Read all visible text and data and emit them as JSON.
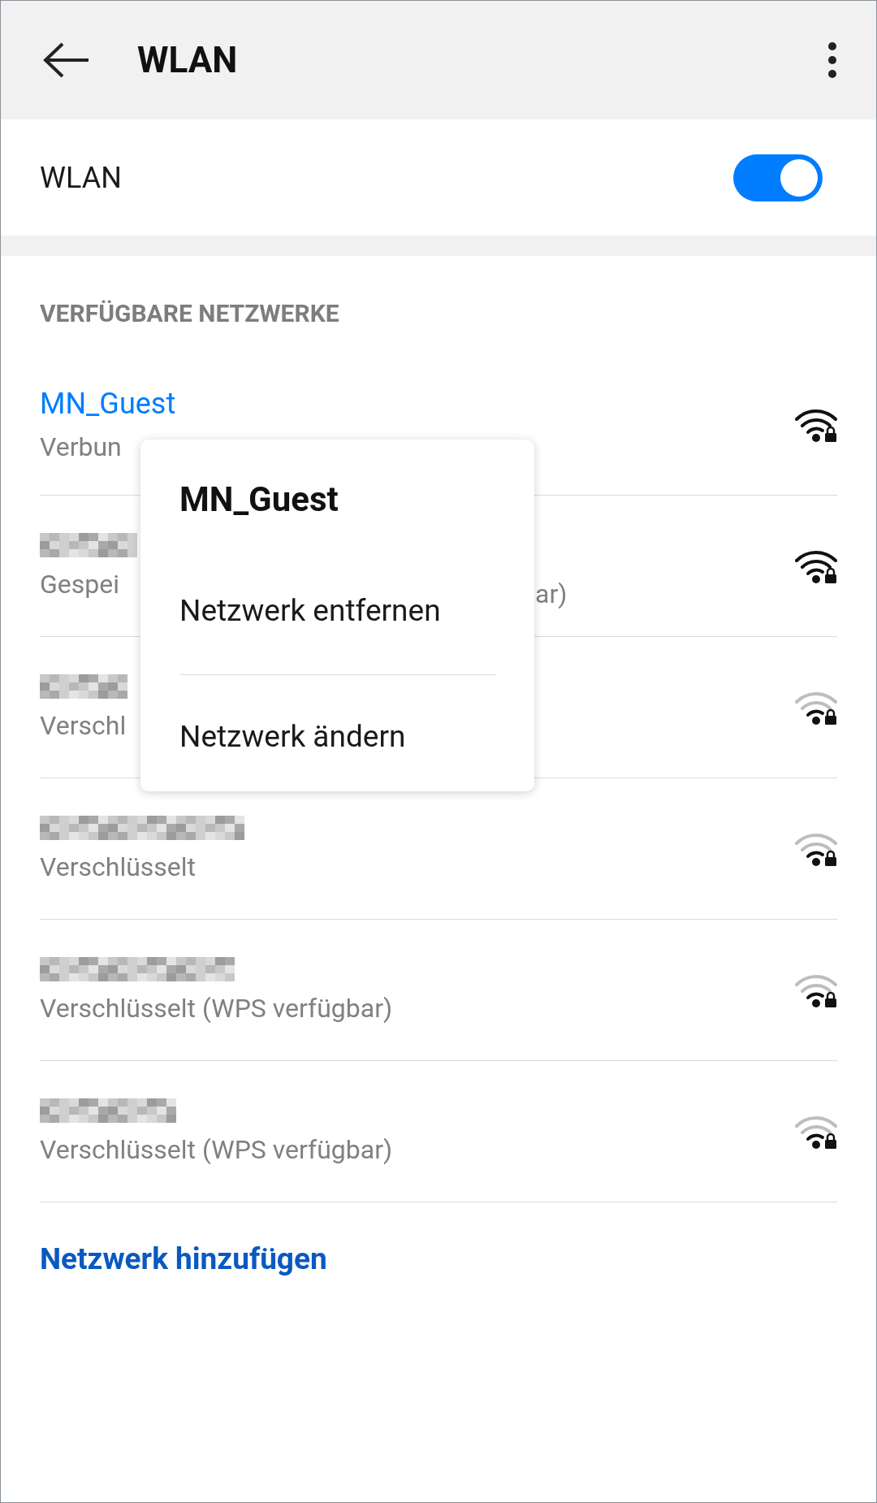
{
  "header": {
    "title": "WLAN"
  },
  "wlan": {
    "label": "WLAN",
    "on": true
  },
  "section_title": "VERFÜGBARE NETZWERKE",
  "networks": [
    {
      "name": "MN_Guest",
      "name_redacted": false,
      "connected": true,
      "status": "Verbun",
      "weak_signal": false
    },
    {
      "name_redacted": true,
      "connected": false,
      "status": "Gespei",
      "status_tail": "ar)",
      "weak_signal": false
    },
    {
      "name_redacted": true,
      "connected": false,
      "status": "Verschl",
      "weak_signal": true
    },
    {
      "name_redacted": true,
      "connected": false,
      "status": "Verschlüsselt",
      "weak_signal": true
    },
    {
      "name_redacted": true,
      "connected": false,
      "status": "Verschlüsselt (WPS verfügbar)",
      "weak_signal": true
    },
    {
      "name_redacted": true,
      "connected": false,
      "status": "Verschlüsselt (WPS verfügbar)",
      "weak_signal": true
    }
  ],
  "add_network": "Netzwerk hinzufügen",
  "popup": {
    "title": "MN_Guest",
    "items": [
      "Netzwerk entfernen",
      "Netzwerk ändern"
    ]
  }
}
